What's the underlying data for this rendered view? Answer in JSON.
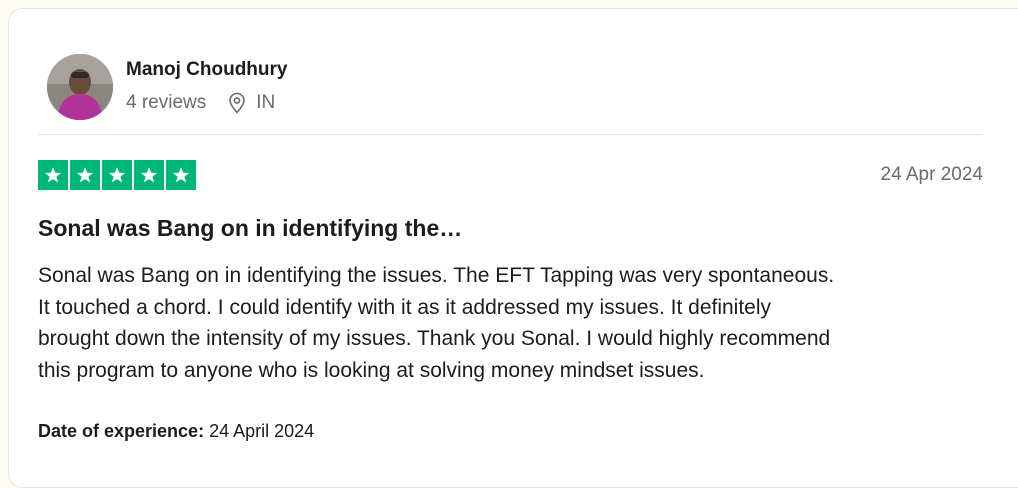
{
  "reviewer": {
    "name": "Manoj Choudhury",
    "reviews_count": "4 reviews",
    "country": "IN"
  },
  "review": {
    "rating": 5,
    "max_rating": 5,
    "date": "24 Apr 2024",
    "title": "Sonal was Bang on in identifying the…",
    "body_lines": [
      "Sonal was Bang on in identifying the issues. The EFT Tapping was very spontaneous.",
      "It touched a chord. I could identify with it as it addressed my issues. It definitely",
      "brought down the intensity of my issues. Thank you Sonal. I would highly recommend",
      "this program to anyone who is looking at solving money mindset issues."
    ],
    "experience_label": "Date of experience:",
    "experience_date": "24 April 2024"
  },
  "icons": {
    "location": "map-pin-icon",
    "star": "star-icon"
  },
  "colors": {
    "star_green": "#00b67a",
    "text_primary": "#1c1c1c",
    "text_secondary": "#6b6b6b",
    "page_background": "#fcfbf3"
  }
}
